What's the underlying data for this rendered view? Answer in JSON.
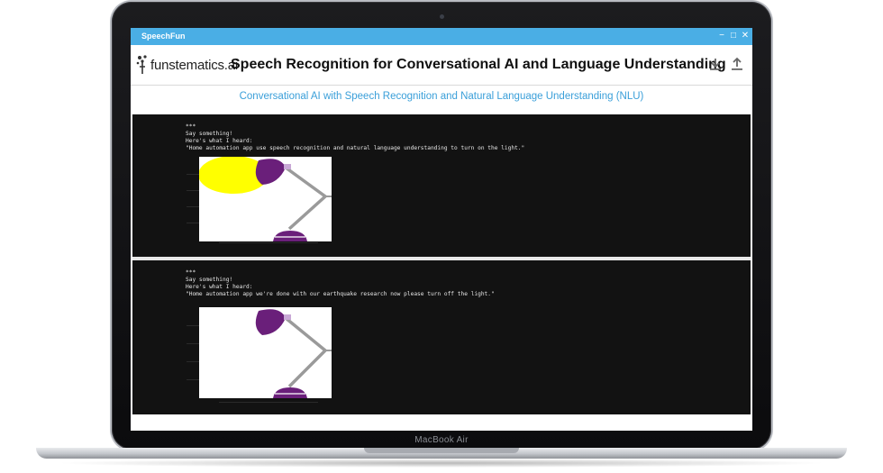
{
  "app": {
    "window_title": "SpeechFun",
    "logo_text": "funstematics.ai",
    "title": "Speech Recognition for Conversational AI and Language Understanding",
    "subtitle": "Conversational AI with Speech Recognition and Natural Language Understanding (NLU)"
  },
  "window_controls": {
    "minimize": "−",
    "maximize": "□",
    "close": "✕"
  },
  "header_icons": [
    "download-icon",
    "upload-icon"
  ],
  "laptop": {
    "model_label": "MacBook Air"
  },
  "outputs": [
    {
      "marker": "***",
      "prompt": "Say something!",
      "heard_label": "Here's what I heard:",
      "transcript": "\"Home automation app use speech recognition and natural language understanding to turn on the light.\"",
      "light_on": true
    },
    {
      "marker": "***",
      "prompt": "Say something!",
      "heard_label": "Here's what I heard:",
      "transcript": "\"Home automation app we're done with our earthquake research now please turn off the light.\"",
      "light_on": false
    }
  ],
  "colors": {
    "accent": "#4aaee5",
    "lamp": "#6a1f7a",
    "light": "#ffff00",
    "arm": "#9a9a9a"
  }
}
